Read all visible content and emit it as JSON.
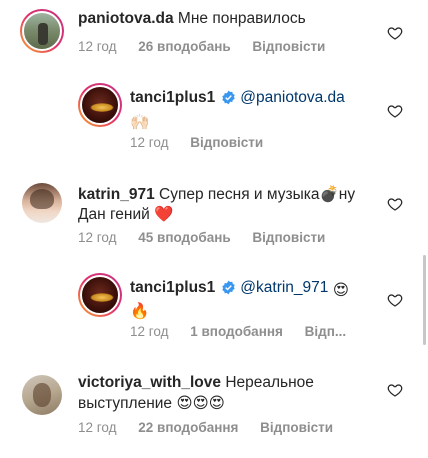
{
  "comments": [
    {
      "username": "paniotova.da",
      "text": "Мне понравилось",
      "time": "12 год",
      "likes": "26 вподобань",
      "reply": "Відповісти"
    },
    {
      "username": "tanci1plus1",
      "mention": "@paniotova.da",
      "emoji": "🙌🏻",
      "time": "12 год",
      "reply": "Відповісти"
    },
    {
      "username": "katrin_971",
      "text_line1": "Супер песня и музыка💣ну",
      "text_line2": "Дан гений ❤️",
      "time": "12 год",
      "likes": "45 вподобань",
      "reply": "Відповісти"
    },
    {
      "username": "tanci1plus1",
      "mention": "@katrin_971",
      "emoji_inline": "😍",
      "emoji": "🔥",
      "time": "12 год",
      "likes": "1 вподобання",
      "reply": "Відп..."
    },
    {
      "username": "victoriya_with_love",
      "text_line1": "Нереальное",
      "text_line2": "выступление 😍😍😍",
      "time": "12 год",
      "likes": "22 вподобання",
      "reply": "Відповісти"
    }
  ],
  "icons": {
    "like": "heart-outline-icon",
    "verified": "verified-badge-icon"
  },
  "colors": {
    "verified": "#3897f0",
    "meta": "#8e8e8e",
    "mention": "#00376b"
  }
}
